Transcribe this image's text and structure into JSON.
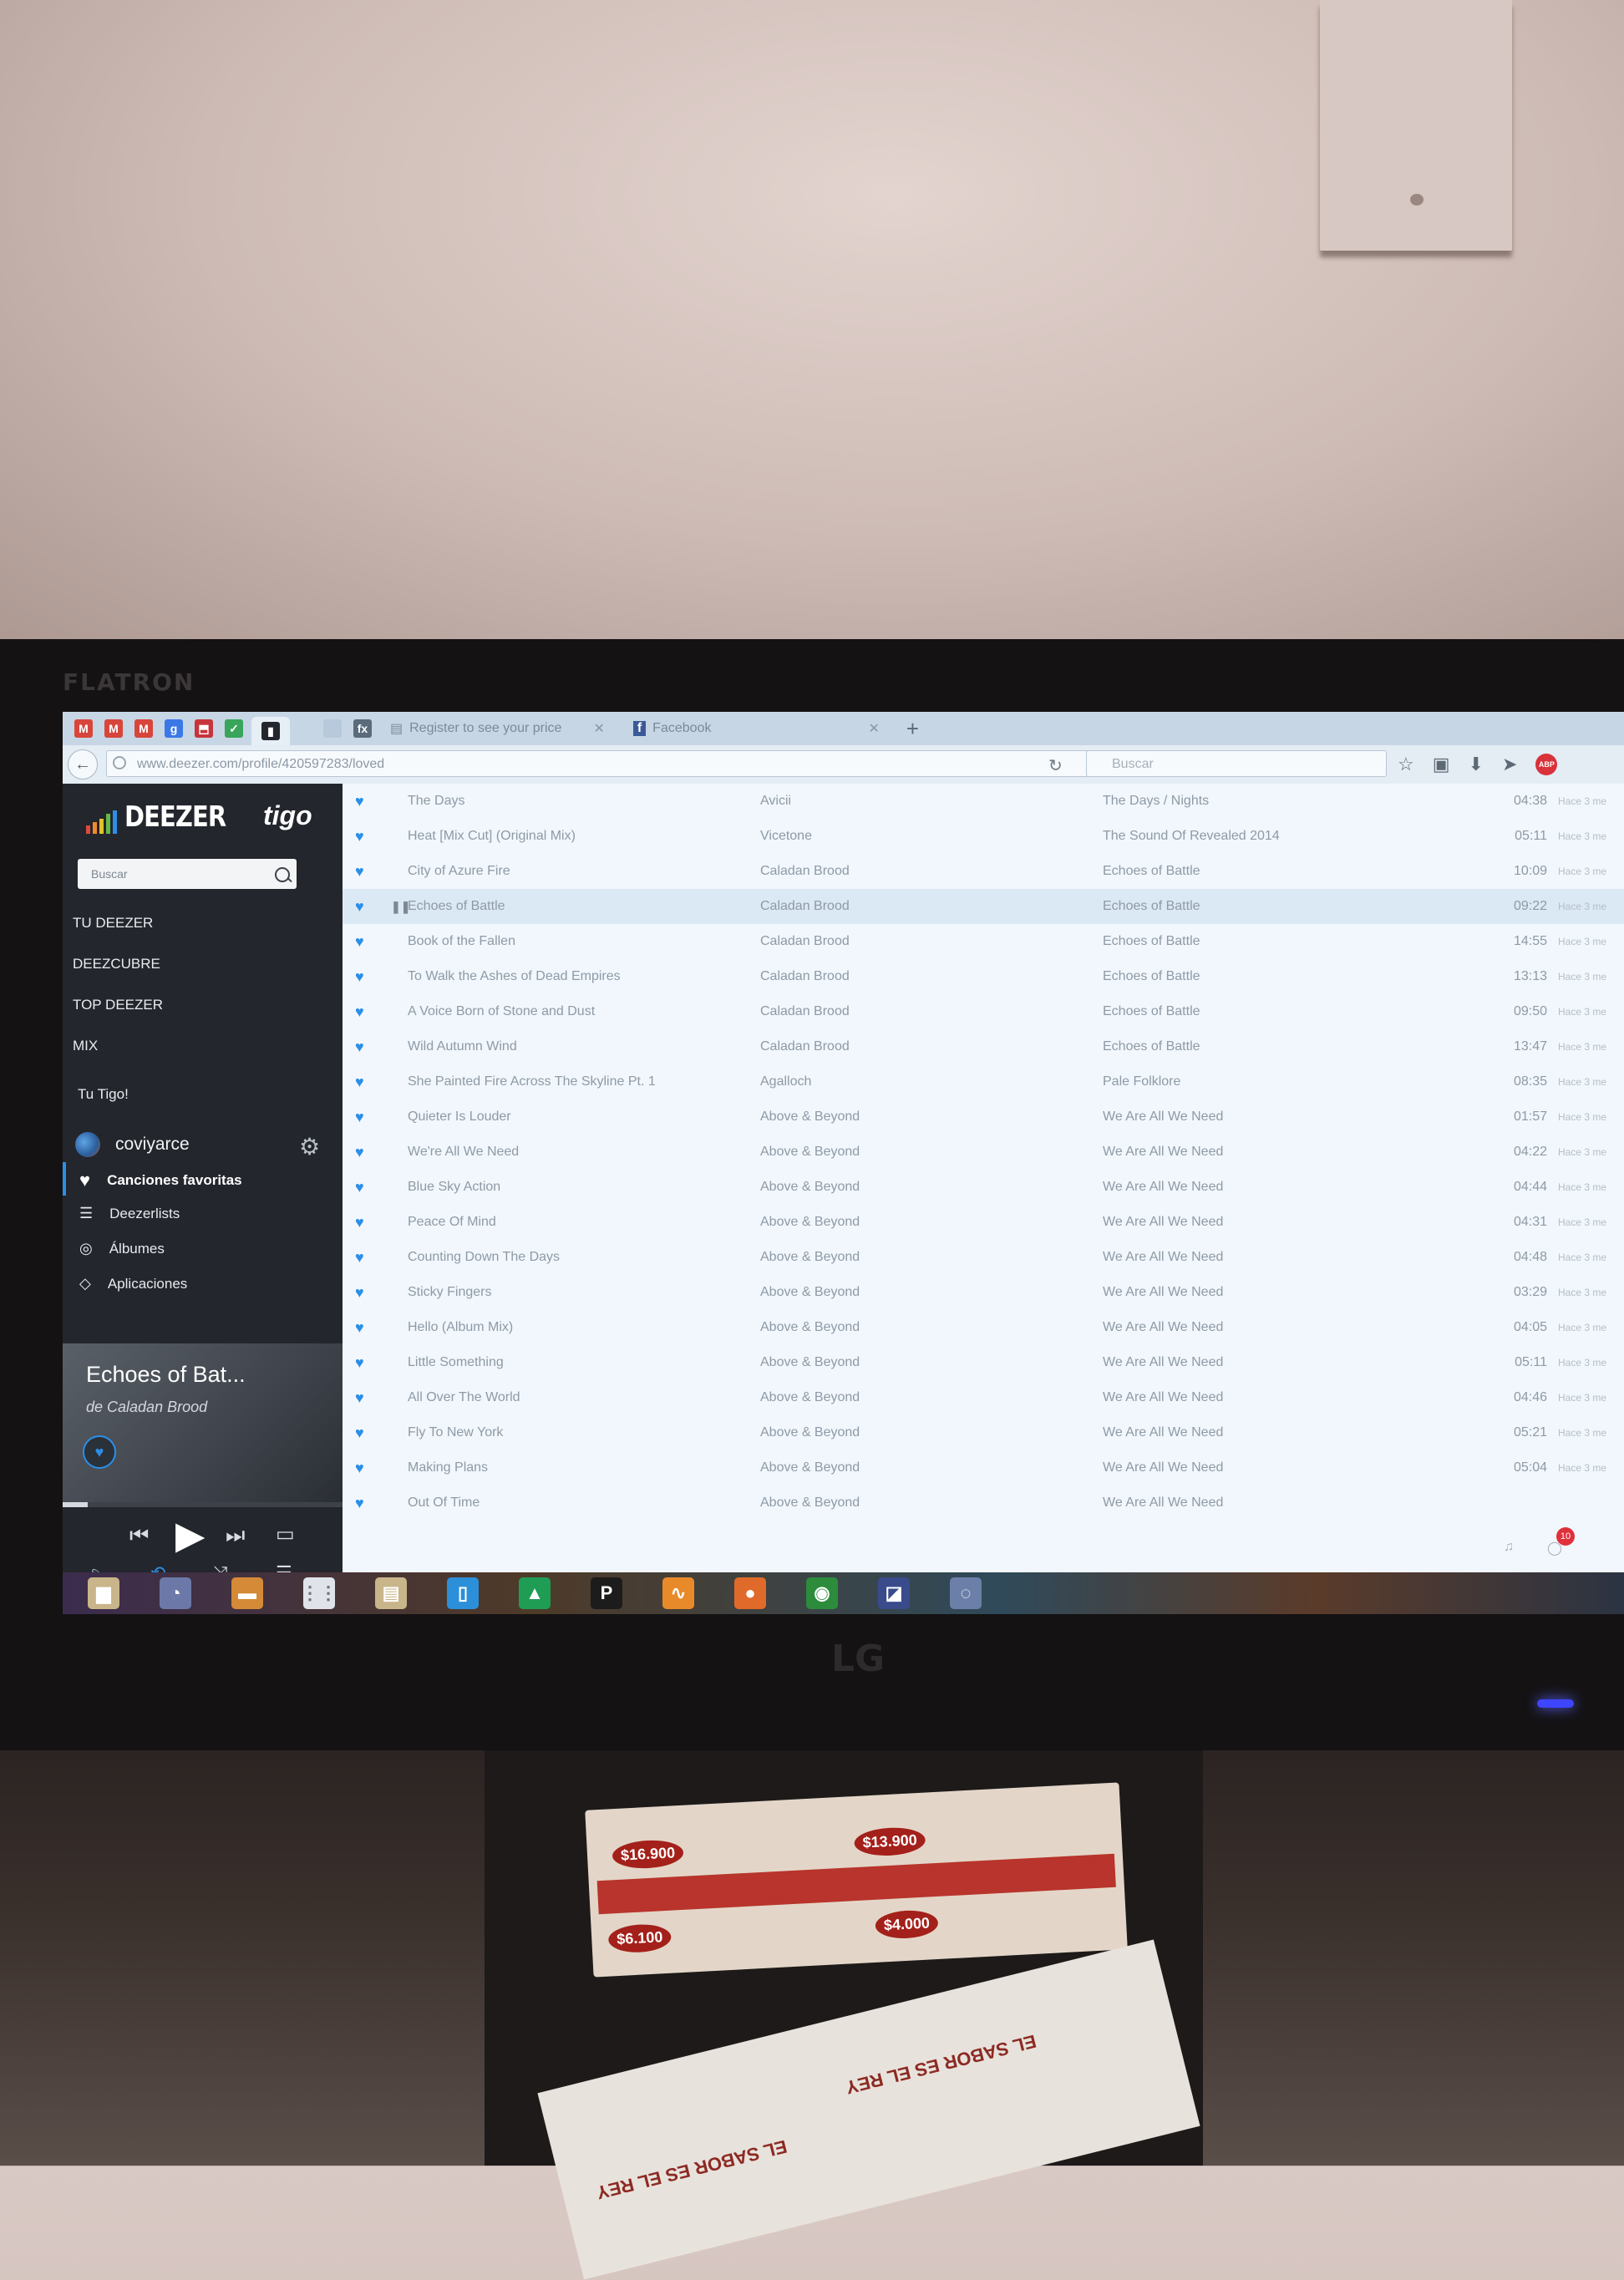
{
  "device": {
    "monitor_brand_top": "FLATRON",
    "monitor_brand_bottom": "LG"
  },
  "browser": {
    "tabs": [
      {
        "label": "Register to see your price",
        "icon": "page-icon"
      },
      {
        "label": "Facebook",
        "icon": "facebook-icon"
      }
    ],
    "new_tab_label": "+",
    "url": "www.deezer.com/profile/420597283/loved",
    "search_placeholder": "Buscar"
  },
  "sidebar": {
    "logo_text": "DEEZER",
    "partner_logo": "tigo",
    "search_placeholder": "Buscar",
    "nav": [
      "TU DEEZER",
      "DEEZCUBRE",
      "TOP DEEZER",
      "MIX"
    ],
    "tu_tigo": "Tu Tigo!",
    "username": "coviyarce",
    "library": [
      {
        "label": "Canciones favoritas",
        "icon": "heart-icon",
        "selected": true
      },
      {
        "label": "Deezerlists",
        "icon": "playlist-icon",
        "selected": false
      },
      {
        "label": "Álbumes",
        "icon": "album-icon",
        "selected": false
      },
      {
        "label": "Aplicaciones",
        "icon": "apps-icon",
        "selected": false
      }
    ]
  },
  "now_playing": {
    "title": "Echoes of Bat...",
    "artist": "de Caladan Brood",
    "progress": 0.09
  },
  "tracks": [
    {
      "title": "The Days",
      "artist": "Avicii",
      "album": "The Days / Nights",
      "time": "04:38",
      "added": "Hace 3 me"
    },
    {
      "title": "Heat [Mix Cut] (Original Mix)",
      "artist": "Vicetone",
      "album": "The Sound Of Revealed 2014",
      "time": "05:11",
      "added": "Hace 3 me"
    },
    {
      "title": "City of Azure Fire",
      "artist": "Caladan Brood",
      "album": "Echoes of Battle",
      "time": "10:09",
      "added": "Hace 3 me"
    },
    {
      "title": "Echoes of Battle",
      "artist": "Caladan Brood",
      "album": "Echoes of Battle",
      "time": "09:22",
      "added": "Hace 3 me",
      "playing": true
    },
    {
      "title": "Book of the Fallen",
      "artist": "Caladan Brood",
      "album": "Echoes of Battle",
      "time": "14:55",
      "added": "Hace 3 me"
    },
    {
      "title": "To Walk the Ashes of Dead Empires",
      "artist": "Caladan Brood",
      "album": "Echoes of Battle",
      "time": "13:13",
      "added": "Hace 3 me"
    },
    {
      "title": "A Voice Born of Stone and Dust",
      "artist": "Caladan Brood",
      "album": "Echoes of Battle",
      "time": "09:50",
      "added": "Hace 3 me"
    },
    {
      "title": "Wild Autumn Wind",
      "artist": "Caladan Brood",
      "album": "Echoes of Battle",
      "time": "13:47",
      "added": "Hace 3 me"
    },
    {
      "title": "She Painted Fire Across The Skyline Pt. 1",
      "artist": "Agalloch",
      "album": "Pale Folklore",
      "time": "08:35",
      "added": "Hace 3 me"
    },
    {
      "title": "Quieter Is Louder",
      "artist": "Above & Beyond",
      "album": "We Are All We Need",
      "time": "01:57",
      "added": "Hace 3 me"
    },
    {
      "title": "We're All We Need",
      "artist": "Above & Beyond",
      "album": "We Are All We Need",
      "time": "04:22",
      "added": "Hace 3 me"
    },
    {
      "title": "Blue Sky Action",
      "artist": "Above & Beyond",
      "album": "We Are All We Need",
      "time": "04:44",
      "added": "Hace 3 me"
    },
    {
      "title": "Peace Of Mind",
      "artist": "Above & Beyond",
      "album": "We Are All We Need",
      "time": "04:31",
      "added": "Hace 3 me"
    },
    {
      "title": "Counting Down The Days",
      "artist": "Above & Beyond",
      "album": "We Are All We Need",
      "time": "04:48",
      "added": "Hace 3 me"
    },
    {
      "title": "Sticky Fingers",
      "artist": "Above & Beyond",
      "album": "We Are All We Need",
      "time": "03:29",
      "added": "Hace 3 me"
    },
    {
      "title": "Hello (Album Mix)",
      "artist": "Above & Beyond",
      "album": "We Are All We Need",
      "time": "04:05",
      "added": "Hace 3 me"
    },
    {
      "title": "Little Something",
      "artist": "Above & Beyond",
      "album": "We Are All We Need",
      "time": "05:11",
      "added": "Hace 3 me"
    },
    {
      "title": "All Over The World",
      "artist": "Above & Beyond",
      "album": "We Are All We Need",
      "time": "04:46",
      "added": "Hace 3 me"
    },
    {
      "title": "Fly To New York",
      "artist": "Above & Beyond",
      "album": "We Are All We Need",
      "time": "05:21",
      "added": "Hace 3 me"
    },
    {
      "title": "Making Plans",
      "artist": "Above & Beyond",
      "album": "We Are All We Need",
      "time": "05:04",
      "added": "Hace 3 me"
    },
    {
      "title": "Out Of Time",
      "artist": "Above & Beyond",
      "album": "We Are All We Need",
      "time": "",
      "added": ""
    }
  ],
  "notification_count": "10",
  "flyer": {
    "prices": [
      "$16.900",
      "$13.900",
      "$6.100",
      "$4.000"
    ],
    "slogan": "EL SABOR ES EL REY"
  },
  "colors": {
    "accent": "#2b8fe8",
    "sidebar": "#23262c",
    "list_bg": "#f1f7fc"
  }
}
